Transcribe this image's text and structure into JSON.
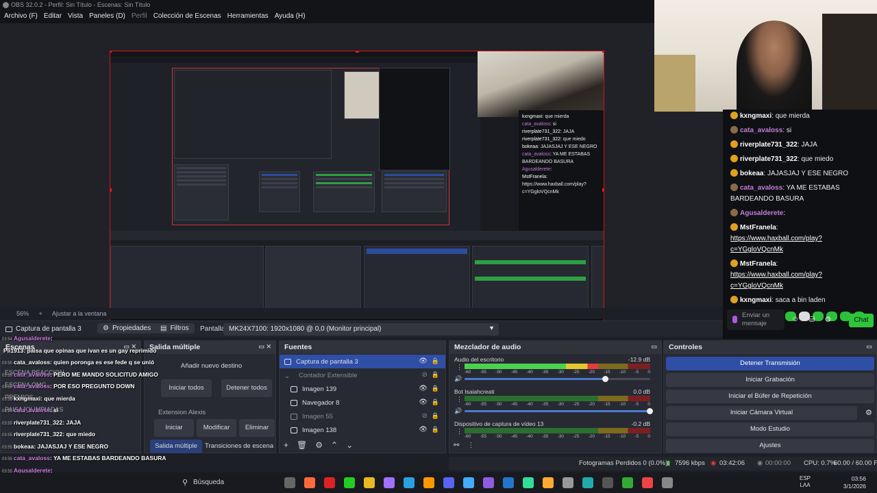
{
  "window_title": "OBS 32.0.2 - Perfil: Sin Título - Escenas: Sin Título",
  "menu": [
    "Archivo (F)",
    "Editar",
    "Vista",
    "Paneles (D)",
    "Perfil",
    "Colección de Escenas",
    "Herramientas",
    "Ayuda (H)"
  ],
  "zoom": {
    "level": "56%",
    "fit_label": "Ajustar a la ventana"
  },
  "source_toolbar": {
    "source_name": "Captura de pantalla 3",
    "properties": "Propiedades",
    "filters": "Filtros",
    "display_label": "Pantalla",
    "display_value": "MK24X7100: 1920x1080 @ 0,0 (Monitor principal)"
  },
  "docks": {
    "scenes": "Escenas",
    "multi": "Salida múltiple",
    "sources": "Fuentes",
    "mixer": "Mezclador de audio",
    "controls": "Controles"
  },
  "scenes_visible": [
    "ESCENA REACCION",
    "ESCENA OMG",
    "PREMIOS",
    "PAISAJOLIMPIADAS"
  ],
  "multi": {
    "add_dest": "Añadir nuevo destino",
    "start_all": "Iniciar todos",
    "stop_all": "Detener todos",
    "ext_label": "Extension Alexis",
    "start": "Iniciar",
    "modify": "Modificar",
    "delete": "Eliminar",
    "tab_multi": "Salida múltiple",
    "tab_trans": "Transiciones de escena"
  },
  "sources": [
    {
      "name": "Captura de pantalla 3",
      "selected": true,
      "dim": false,
      "indent": false
    },
    {
      "name": "Contador Extensible",
      "selected": false,
      "dim": true,
      "indent": false,
      "group": true
    },
    {
      "name": "Imagen 139",
      "selected": false,
      "dim": false,
      "indent": true
    },
    {
      "name": "Navegador 8",
      "selected": false,
      "dim": false,
      "indent": true
    },
    {
      "name": "Imagen 55",
      "selected": false,
      "dim": true,
      "indent": true
    },
    {
      "name": "Imagen 138",
      "selected": false,
      "dim": false,
      "indent": true
    }
  ],
  "mixer": [
    {
      "name": "Audio del escritorio",
      "db": "-12.9 dB",
      "level": 0.72,
      "volume": 0.76
    },
    {
      "name": "Bot Isaiahcreati",
      "db": "0.0 dB",
      "level": 0.0,
      "volume": 1.0
    },
    {
      "name": "Dispositivo de captura de vídeo 13",
      "db": "-0.2 dB",
      "level": 0.0,
      "volume": 1.0
    }
  ],
  "mixer_ticks": [
    "-60",
    "-55",
    "-50",
    "-45",
    "-40",
    "-35",
    "-30",
    "-25",
    "-20",
    "-15",
    "-10",
    "-5",
    "0"
  ],
  "controls": [
    {
      "label": "Detener Transmisión",
      "active": true
    },
    {
      "label": "Iniciar Grabación",
      "active": false
    },
    {
      "label": "Iniciar el Búfer de Repetición",
      "active": false
    },
    {
      "label": "Iniciar Cámara Virtual",
      "active": false
    },
    {
      "label": "Modo Estudio",
      "active": false
    },
    {
      "label": "Ajustes",
      "active": false
    }
  ],
  "status": {
    "dropped": "Fotogramas Perdidos 0 (0.0%)",
    "kbps": "7596 kbps",
    "stream_time": "03:42:06",
    "rec_time": "00:00:00",
    "cpu": "CPU: 0.7%",
    "fps": "60.00 / 60.00 FPS"
  },
  "overlay_chat": [
    {
      "time": "03:54",
      "user": "Agusalderete",
      "text": ":",
      "purple": true
    },
    {
      "time": "",
      "user": "Pii1913",
      "text": ": paisa que opinas que ivan es un gay reprimido",
      "purple": false
    },
    {
      "time": "03:55",
      "user": "cata_avaloss",
      "text": ": quien poronga es ese fede q se unió",
      "purple": false
    },
    {
      "time": "03:55",
      "user": "cata_avaloss",
      "text": ": PERO ME MANDO SOLICITUD AMIGO",
      "purple": true
    },
    {
      "time": "03:55",
      "user": "cata_avaloss",
      "text": ": POR ESO PREGUNTO DOWN",
      "purple": true
    },
    {
      "time": "03:55",
      "user": "kxngmaxi",
      "text": ": que mierda",
      "purple": false
    },
    {
      "time": "03:55",
      "user": "cata_avaloss",
      "text": ": si",
      "purple": true
    },
    {
      "time": "03:55",
      "user": "riverplate731_322",
      "text": ": JAJA",
      "purple": false
    },
    {
      "time": "03:55",
      "user": "riverplate731_322",
      "text": ": que miedo",
      "purple": false
    },
    {
      "time": "03:55",
      "user": "bokeaa",
      "text": ": JAJASJAJ Y ESE NEGRO",
      "purple": false
    },
    {
      "time": "03:55",
      "user": "cata_avaloss",
      "text": ": YA ME ESTABAS BARDEANDO BASURA",
      "purple": true
    },
    {
      "time": "03:55",
      "user": "Agusalderete",
      "text": ":",
      "purple": true
    },
    {
      "time": "03:55",
      "user": "MstFranela",
      "text": ": https://www.haxball.com/play?c=YGgloVQcnMk",
      "purple": false
    },
    {
      "time": "03:55",
      "user": "MstFranela",
      "text": ": https://www.haxball.com/play?c=YGgloVQcnMk",
      "purple": false
    },
    {
      "time": "03:55",
      "user": "kxngmaxi",
      "text": ": saca a bin laden",
      "purple": false
    }
  ],
  "right_chat": [
    {
      "user": "kxngmaxi",
      "text": ": que mierda",
      "purple": false,
      "link": false
    },
    {
      "user": "cata_avaloss",
      "text": ": si",
      "purple": true,
      "link": false
    },
    {
      "user": "riverplate731_322",
      "text": ": JAJA",
      "purple": false,
      "link": false
    },
    {
      "user": "riverplate731_322",
      "text": ": que miedo",
      "purple": false,
      "link": false
    },
    {
      "user": "bokeaa",
      "text": ": JAJASJAJ Y ESE NEGRO",
      "purple": false,
      "link": false
    },
    {
      "user": "cata_avaloss",
      "text": ": YA ME ESTABAS BARDEANDO BASURA",
      "purple": true,
      "link": false
    },
    {
      "user": "Agusalderete",
      "text": ":",
      "purple": true,
      "link": false
    },
    {
      "user": "MstFranela",
      "text": "https://www.haxball.com/play?c=YGgloVQcnMk",
      "purple": false,
      "link": true
    },
    {
      "user": "MstFranela",
      "text": "https://www.haxball.com/play?c=YGgloVQcnMk",
      "purple": false,
      "link": true
    },
    {
      "user": "kxngmaxi",
      "text": ": saca a bin laden",
      "purple": false,
      "link": false
    }
  ],
  "chat_input": {
    "placeholder": "Enviar un mensaje",
    "send": "Chat"
  },
  "taskbar": {
    "search": "Búsqueda",
    "lang": "ESP",
    "lang2": "LAA",
    "time": "03:56",
    "date": "3/1/2026"
  },
  "colors": {
    "accent": "#2f4fa6",
    "preview_border": "#dd1111",
    "chat_purple": "#c37cdb",
    "twitch_green": "#2fc53b"
  }
}
